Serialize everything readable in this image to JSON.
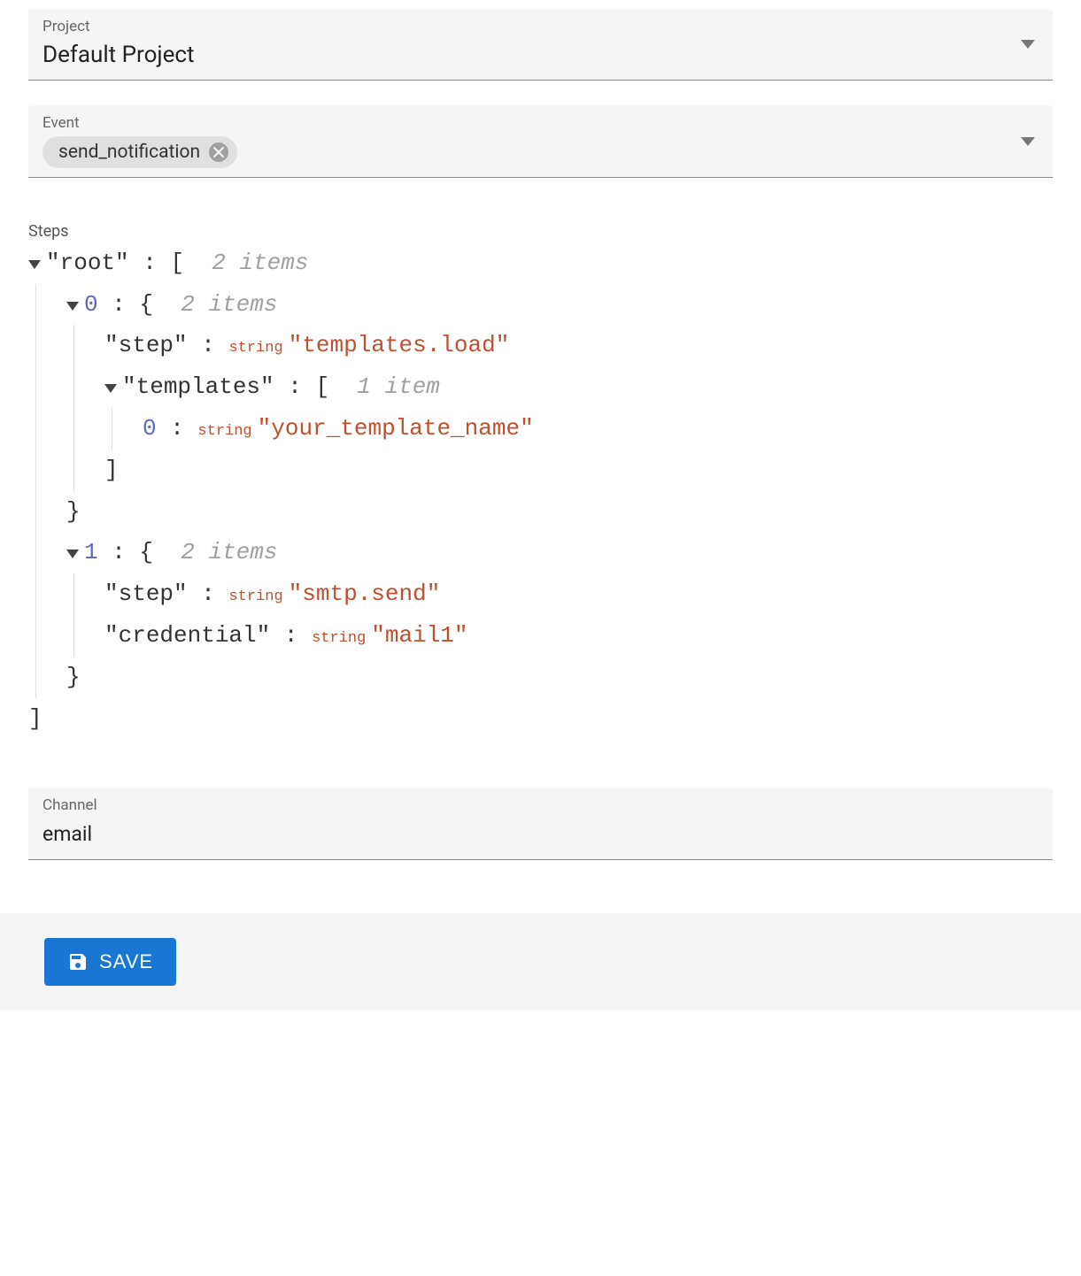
{
  "project": {
    "label": "Project",
    "value": "Default Project"
  },
  "event": {
    "label": "Event",
    "chip": "send_notification"
  },
  "steps": {
    "label": "Steps",
    "root_key": "root",
    "root_meta": "2 items",
    "items": [
      {
        "index": "0",
        "meta": "2 items",
        "fields": {
          "step_key": "step",
          "step_type": "string",
          "step_val": "templates.load",
          "templates_key": "templates",
          "templates_meta": "1 item",
          "tpl_idx": "0",
          "tpl_type": "string",
          "tpl_val": "your_template_name"
        }
      },
      {
        "index": "1",
        "meta": "2 items",
        "fields": {
          "step_key": "step",
          "step_type": "string",
          "step_val": "smtp.send",
          "cred_key": "credential",
          "cred_type": "string",
          "cred_val": "mail1"
        }
      }
    ]
  },
  "channel": {
    "label": "Channel",
    "value": "email"
  },
  "save": {
    "label": "SAVE"
  }
}
